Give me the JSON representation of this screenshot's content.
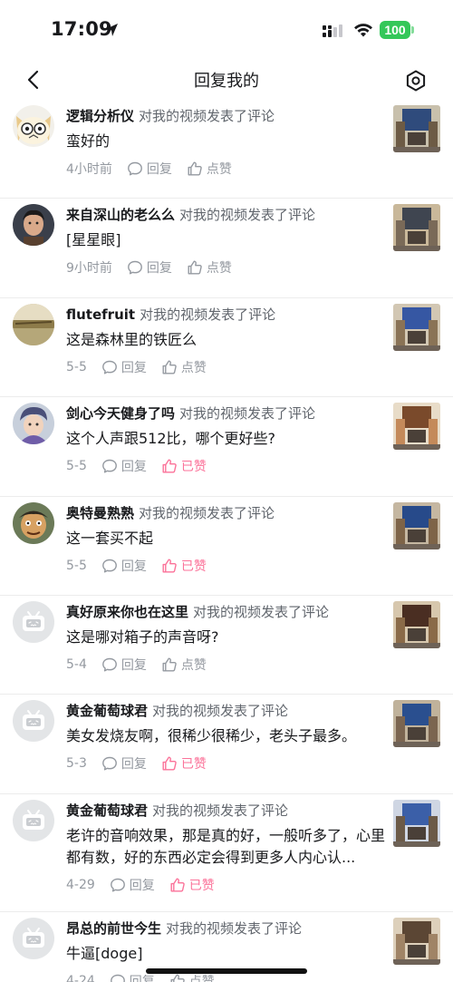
{
  "status_bar": {
    "time": "17:09",
    "battery": "100"
  },
  "nav": {
    "title": "回复我的"
  },
  "action_text": "对我的视频发表了评论",
  "reply_label": "回复",
  "like_label": "点赞",
  "liked_label": "已赞",
  "items": [
    {
      "username": "逻辑分析仪",
      "comment": "蛮好的",
      "time": "4小时前",
      "liked": false,
      "avatar": "cat"
    },
    {
      "username": "来自深山的老么么",
      "comment": "[星星眼]",
      "time": "9小时前",
      "liked": false,
      "avatar": "man"
    },
    {
      "username": "flutefruit",
      "comment": "这是森林里的铁匠么",
      "time": "5-5",
      "liked": false,
      "avatar": "landscape"
    },
    {
      "username": "剑心今天健身了吗",
      "comment": "这个人声跟512比，哪个更好些?",
      "time": "5-5",
      "liked": true,
      "avatar": "anime"
    },
    {
      "username": "奥特曼熟熟",
      "comment": "这一套买不起",
      "time": "5-5",
      "liked": true,
      "avatar": "cartoon"
    },
    {
      "username": "真好原来你也在这里",
      "comment": "这是哪对箱子的声音呀?",
      "time": "5-4",
      "liked": false,
      "avatar": "default"
    },
    {
      "username": "黄金葡萄球君",
      "comment": "美女发烧友啊，很稀少很稀少，老头子最多。",
      "time": "5-3",
      "liked": true,
      "avatar": "default"
    },
    {
      "username": "黄金葡萄球君",
      "comment": "老许的音响效果，那是真的好，一般听多了，心里都有数，好的东西必定会得到更多人内心认...",
      "time": "4-29",
      "liked": true,
      "avatar": "default"
    },
    {
      "username": "昂总的前世今生",
      "comment": "牛逼[doge]",
      "time": "4-24",
      "liked": false,
      "avatar": "default"
    }
  ],
  "colors": {
    "liked": "#fb7299",
    "muted": "#9499a0",
    "battery": "#34c759"
  }
}
